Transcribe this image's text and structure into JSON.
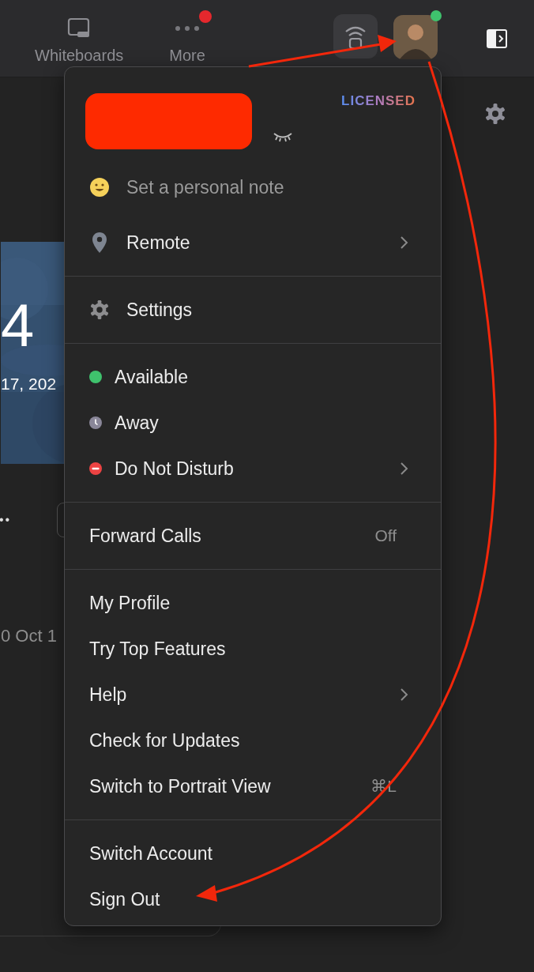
{
  "toolbar": {
    "items": [
      {
        "kind": "whiteboard",
        "label": "Whiteboards",
        "badge": false
      },
      {
        "kind": "more",
        "label": "More",
        "badge": true
      }
    ],
    "avatar": {
      "online": true
    }
  },
  "calendar": {
    "day": "4",
    "date": "17, 202",
    "more": "••",
    "meeting_time": "0 Oct 1"
  },
  "menu": {
    "license": "LICENSED",
    "sections": [
      [
        {
          "kind": "note",
          "label": "Set a personal note",
          "submenu": false
        },
        {
          "kind": "location",
          "label": "Remote",
          "submenu": true
        }
      ],
      [
        {
          "kind": "settings",
          "label": "Settings",
          "submenu": false
        }
      ],
      [
        {
          "kind": "status",
          "label": "Available",
          "color": "#3fc26d",
          "submenu": false
        },
        {
          "kind": "status-away",
          "label": "Away",
          "color": "#8a8799",
          "submenu": false
        },
        {
          "kind": "status-busy",
          "label": "Do Not Disturb",
          "color": "#ec4343",
          "submenu": true
        }
      ],
      [
        {
          "kind": "plain",
          "label": "Forward Calls",
          "value": "Off",
          "submenu": false
        }
      ],
      [
        {
          "kind": "plain",
          "label": "My Profile",
          "submenu": false
        },
        {
          "kind": "plain",
          "label": "Try Top Features",
          "submenu": false
        },
        {
          "kind": "plain",
          "label": "Help",
          "submenu": true
        },
        {
          "kind": "plain",
          "label": "Check for Updates",
          "submenu": false
        },
        {
          "kind": "plain",
          "label": "Switch to Portrait View",
          "value": "⌘L",
          "submenu": false
        }
      ],
      [
        {
          "kind": "plain",
          "label": "Switch Account",
          "submenu": false
        },
        {
          "kind": "plain",
          "label": "Sign Out",
          "submenu": false
        }
      ]
    ]
  }
}
